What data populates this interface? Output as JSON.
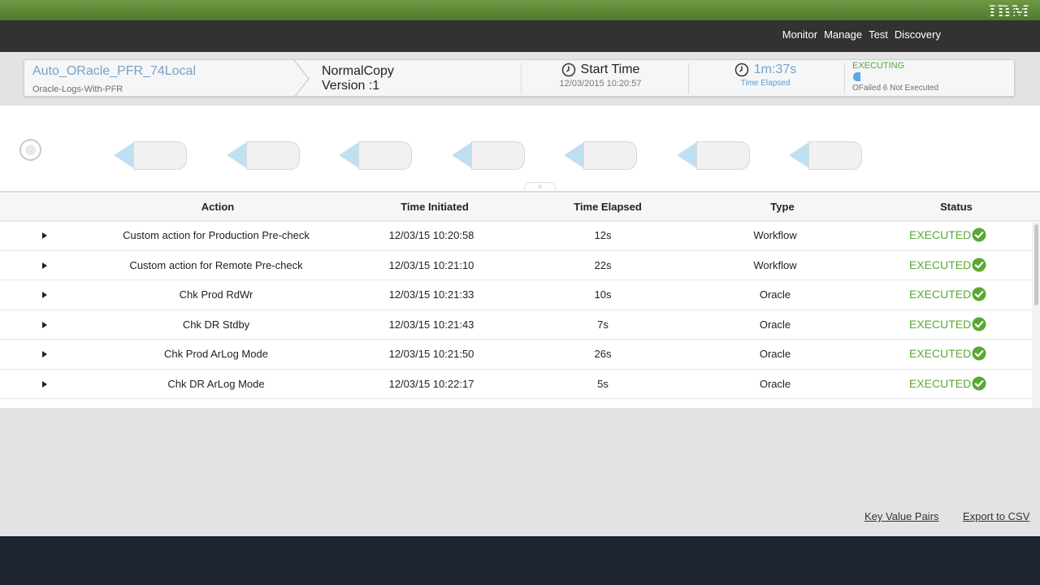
{
  "header": {
    "brand": "IBM"
  },
  "nav": {
    "items": [
      "Monitor",
      "Manage",
      "Test",
      "Discovery"
    ]
  },
  "summary": {
    "name": "Auto_ORacle_PFR_74Local",
    "subname": "Oracle-Logs-With-PFR",
    "copy_type": "NormalCopy",
    "version": "Version :1",
    "start_label": "Start Time",
    "start_value": "12/03/2015 10:20:57",
    "elapsed_value": "1m:37s",
    "elapsed_label": "Time Elapsed",
    "status": "EXECUTING",
    "status_detail": "OFailed 6 Not Executed",
    "colors": {
      "accent": "#7ba0c4",
      "success": "#5aa834",
      "progress": "#5aa7e9"
    }
  },
  "workflow": {
    "step_count": 7,
    "handle_glyph": "="
  },
  "table": {
    "columns": [
      "Action",
      "Time Initiated",
      "Time Elapsed",
      "Type",
      "Status"
    ],
    "rows": [
      {
        "action": "Custom action for Production Pre-check",
        "time_initiated": "12/03/15 10:20:58",
        "elapsed": "12s",
        "type": "Workflow",
        "status": "EXECUTED"
      },
      {
        "action": "Custom action for Remote Pre-check",
        "time_initiated": "12/03/15 10:21:10",
        "elapsed": "22s",
        "type": "Workflow",
        "status": "EXECUTED"
      },
      {
        "action": "Chk Prod RdWr",
        "time_initiated": "12/03/15 10:21:33",
        "elapsed": "10s",
        "type": "Oracle",
        "status": "EXECUTED"
      },
      {
        "action": "Chk DR Stdby",
        "time_initiated": "12/03/15 10:21:43",
        "elapsed": "7s",
        "type": "Oracle",
        "status": "EXECUTED"
      },
      {
        "action": "Chk Prod ArLog Mode",
        "time_initiated": "12/03/15 10:21:50",
        "elapsed": "26s",
        "type": "Oracle",
        "status": "EXECUTED"
      },
      {
        "action": "Chk DR ArLog Mode",
        "time_initiated": "12/03/15 10:22:17",
        "elapsed": "5s",
        "type": "Oracle",
        "status": "EXECUTED"
      }
    ]
  },
  "footer": {
    "kv_link": "Key Value Pairs",
    "export_link": "Export to CSV"
  }
}
